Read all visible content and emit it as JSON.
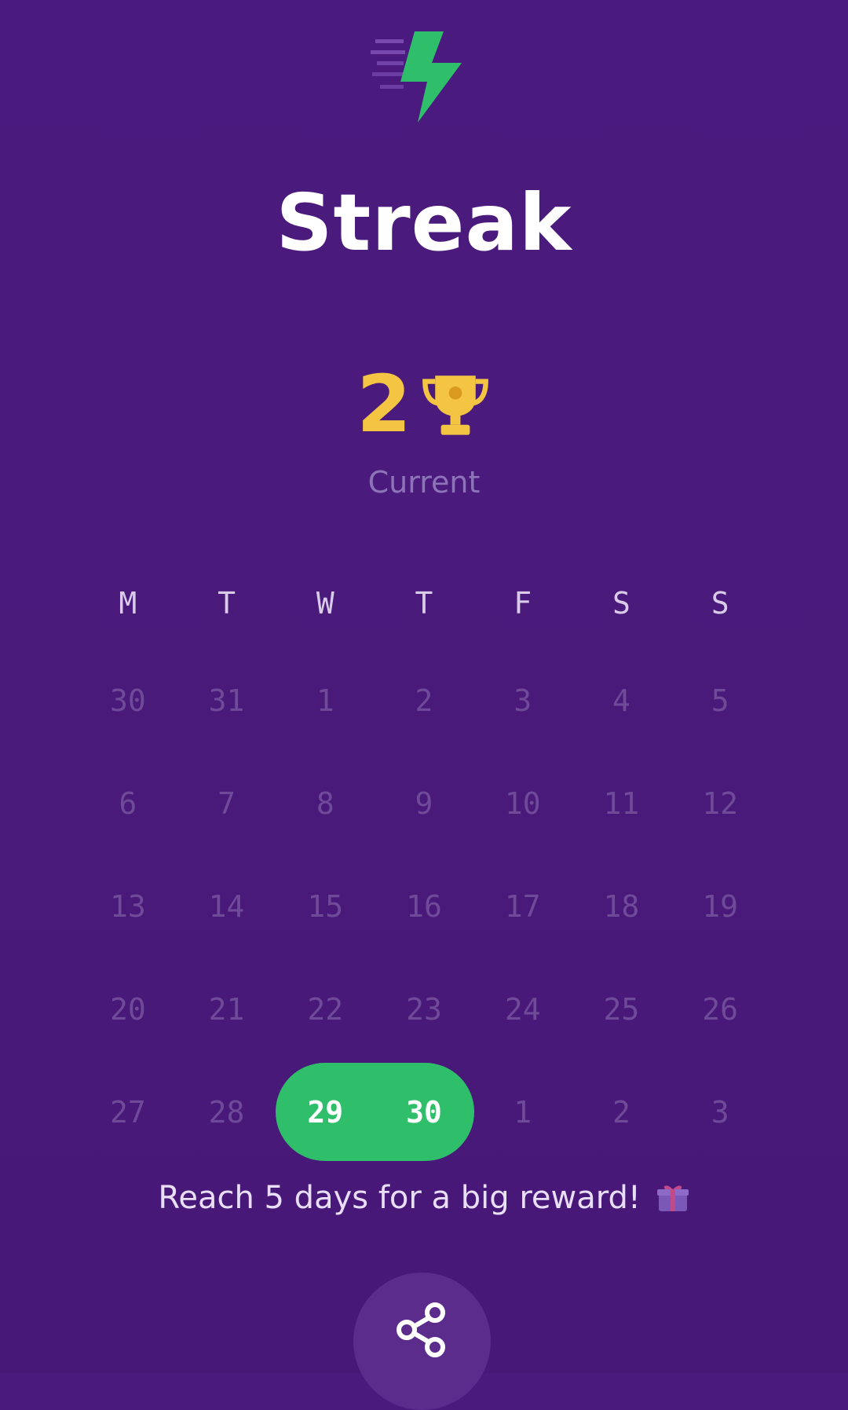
{
  "title": "Streak",
  "streak": {
    "count": "2",
    "label": "Current",
    "icon": "trophy-icon"
  },
  "calendar": {
    "weekdays": [
      "M",
      "T",
      "W",
      "T",
      "F",
      "S",
      "S"
    ],
    "weeks": [
      [
        "30",
        "31",
        "1",
        "2",
        "3",
        "4",
        "5"
      ],
      [
        "6",
        "7",
        "8",
        "9",
        "10",
        "11",
        "12"
      ],
      [
        "13",
        "14",
        "15",
        "16",
        "17",
        "18",
        "19"
      ],
      [
        "20",
        "21",
        "22",
        "23",
        "24",
        "25",
        "26"
      ],
      [
        "27",
        "28",
        "29",
        "30",
        "1",
        "2",
        "3"
      ]
    ],
    "active_days": [
      "29",
      "30"
    ]
  },
  "hint": {
    "text": "Reach 5 days for a big reward!",
    "icon": "gift-icon"
  },
  "share": {
    "icon": "share-icon"
  },
  "colors": {
    "background": "#4a1a7c",
    "accent_green": "#2fbf6a",
    "trophy_gold": "#f4c542"
  }
}
